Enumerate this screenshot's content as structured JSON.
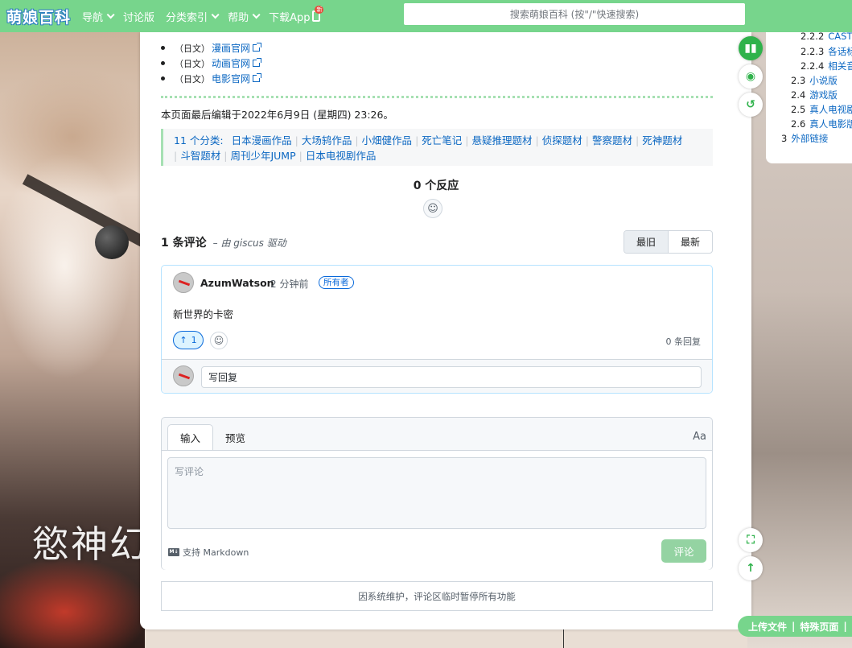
{
  "site": {
    "logo": "萌娘百科"
  },
  "nav": {
    "items": [
      "导航",
      "讨论版",
      "分类索引",
      "帮助",
      "下载App"
    ],
    "new_badge": "新",
    "search_placeholder": "搜索萌娘百科 (按\"/\"快速搜索)"
  },
  "background": {
    "title_text": "慾神幻"
  },
  "links": [
    {
      "lang": "（日文）",
      "label": "漫画官网"
    },
    {
      "lang": "（日文）",
      "label": "动画官网"
    },
    {
      "lang": "（日文）",
      "label": "电影官网"
    }
  ],
  "last_edit": "本页面最后编辑于2022年6月9日 (星期四) 23:26。",
  "categories": {
    "label": "11 个分类:",
    "items": [
      "日本漫画作品",
      "大场鸫作品",
      "小畑健作品",
      "死亡笔记",
      "悬疑推理题材",
      "侦探题材",
      "警察题材",
      "死神题材",
      "斗智题材",
      "周刊少年JUMP",
      "日本电视剧作品"
    ]
  },
  "reactions": {
    "title": "0 个反应"
  },
  "comments": {
    "count": "1 条评论",
    "powered_by": "– 由 giscus 驱动",
    "sort": [
      "最旧",
      "最新"
    ],
    "list": [
      {
        "author": "AzumWatson",
        "time": "2 分钟前",
        "badge": "所有者",
        "text": "新世界的卡密",
        "upvotes": "1",
        "replies": "0 条回复"
      }
    ],
    "reply_placeholder": "写回复"
  },
  "editor": {
    "tabs": [
      "输入",
      "预览"
    ],
    "font_toggle": "Aa",
    "placeholder": "写评论",
    "markdown_icon": "M↓",
    "markdown_note": "支持 Markdown",
    "submit": "评论"
  },
  "maintenance_notice": "因系统维护，评论区临时暂停所有功能",
  "toc": [
    {
      "num": "2.2.2",
      "title": "CAST"
    },
    {
      "num": "2.2.3",
      "title": "各话标"
    },
    {
      "num": "2.2.4",
      "title": "相关音"
    },
    {
      "num": "2.3",
      "title": "小说版"
    },
    {
      "num": "2.4",
      "title": "游戏版"
    },
    {
      "num": "2.5",
      "title": "真人电视剧"
    },
    {
      "num": "2.6",
      "title": "真人电影版"
    },
    {
      "num": "3",
      "title": "外部链接"
    }
  ],
  "footer_actions": [
    "上传文件",
    "特殊页面"
  ],
  "footer_sep": "|",
  "icons": {
    "float_buttons": [
      "book-icon",
      "eye-icon",
      "history-icon",
      "fullscreen-icon",
      "arrow-up-icon"
    ],
    "react": "smiley-icon",
    "ext_link": "external-link-icon"
  },
  "colors": {
    "topbar": "#77d58c",
    "link": "#0b67c2",
    "accent": "#2fb24b"
  }
}
